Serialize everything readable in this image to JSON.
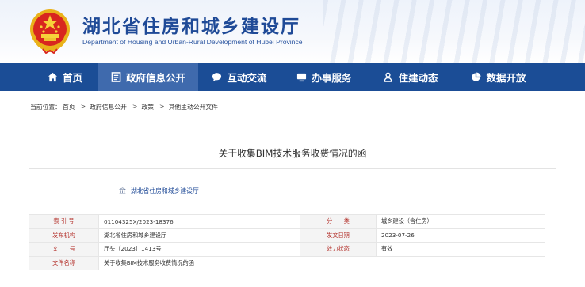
{
  "header": {
    "title": "湖北省住房和城乡建设厅",
    "subtitle": "Department of Housing and Urban-Rural Development of Hubei Province"
  },
  "nav": {
    "items": [
      {
        "label": "首页",
        "icon": "home-icon"
      },
      {
        "label": "政府信息公开",
        "icon": "document-list-icon",
        "active": true
      },
      {
        "label": "互动交流",
        "icon": "chat-bubble-icon"
      },
      {
        "label": "办事服务",
        "icon": "monitor-icon"
      },
      {
        "label": "住建动态",
        "icon": "person-icon"
      },
      {
        "label": "数据开放",
        "icon": "pie-chart-icon"
      }
    ]
  },
  "breadcrumb": {
    "prefix": "当前位置：",
    "items": [
      "首页",
      "政府信息公开",
      "政策",
      "其他主动公开文件"
    ],
    "separator": ">"
  },
  "article": {
    "title": "关于收集BIM技术服务收费情况的函",
    "publisher": "湖北省住房和城乡建设厅"
  },
  "info_table": {
    "rows": [
      {
        "l1": "索 引 号",
        "v1": "01104325X/2023-18376",
        "l2": "分　　类",
        "v2": "城乡建设（含住房）"
      },
      {
        "l1": "发布机构",
        "v1": "湖北省住房和城乡建设厅",
        "l2": "发文日期",
        "v2": "2023-07-26"
      },
      {
        "l1": "文　　号",
        "v1": "厅头〔2023〕1413号",
        "l2": "效力状态",
        "v2": "有效"
      },
      {
        "l1": "文件名称",
        "v1": "关于收集BIM技术服务收费情况的函"
      }
    ]
  },
  "colors": {
    "nav_bg": "#1b4d96",
    "nav_active": "#3f6aad",
    "title_blue": "#1f4a97",
    "label_red": "#b4322c"
  }
}
